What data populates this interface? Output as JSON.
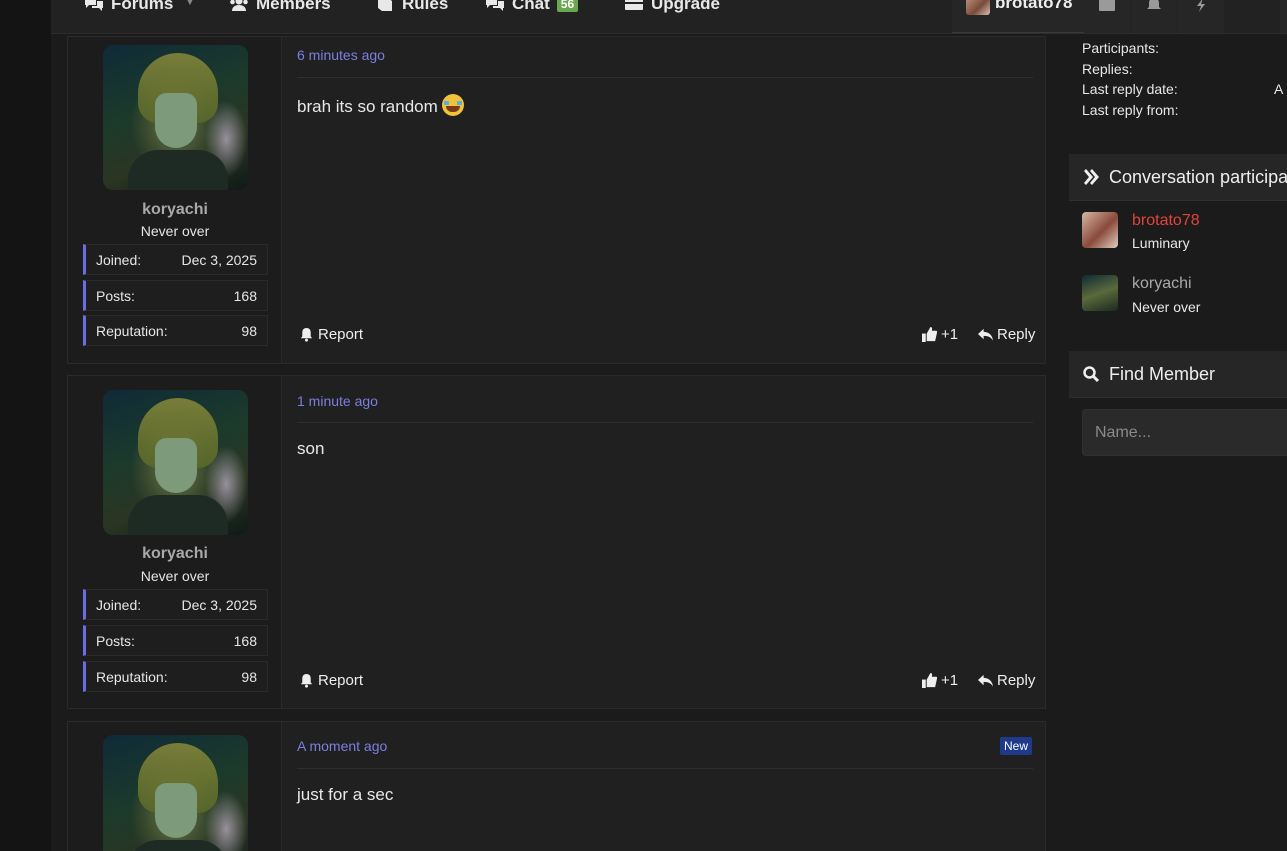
{
  "nav": {
    "items": [
      {
        "label": "Forums",
        "icon": "chat-bubbles-icon"
      },
      {
        "label": "Members",
        "icon": "users-icon"
      },
      {
        "label": "Rules",
        "icon": "book-icon"
      },
      {
        "label": "Chat",
        "icon": "chat-bubbles-icon",
        "badge": "56"
      },
      {
        "label": "Upgrade",
        "icon": "card-icon"
      }
    ],
    "user": "brotato78"
  },
  "posts": [
    {
      "author": "koryachi",
      "user_title": "Never over",
      "stats": [
        {
          "k": "Joined:",
          "v": "Dec 3, 2025"
        },
        {
          "k": "Posts:",
          "v": "168"
        },
        {
          "k": "Reputation:",
          "v": "98"
        }
      ],
      "time": "6 minutes ago",
      "text": "brah its so random",
      "emoji": "loudly-crying-face",
      "report": "Report",
      "like": "+1",
      "reply": "Reply"
    },
    {
      "author": "koryachi",
      "user_title": "Never over",
      "stats": [
        {
          "k": "Joined:",
          "v": "Dec 3, 2025"
        },
        {
          "k": "Posts:",
          "v": "168"
        },
        {
          "k": "Reputation:",
          "v": "98"
        }
      ],
      "time": "1 minute ago",
      "text": "son",
      "report": "Report",
      "like": "+1",
      "reply": "Reply"
    },
    {
      "time": "A moment ago",
      "text": "just for a sec",
      "badge": "New"
    }
  ],
  "sidebar": {
    "info": {
      "participants": "Participants:",
      "replies": "Replies:",
      "last_reply_date": "Last reply date:",
      "last_reply_date_value": "A",
      "last_reply_from": "Last reply from:"
    },
    "participants_title": "Conversation participa",
    "participants": [
      {
        "name": "brotato78",
        "title": "Luminary",
        "color": "#e0443a"
      },
      {
        "name": "koryachi",
        "title": "Never over",
        "color": "#a9a9a9"
      }
    ],
    "find_title": "Find Member",
    "find_placeholder": "Name..."
  },
  "colors": {
    "accent": "#6a6fe0",
    "link": "#7b7fe0",
    "chat_badge": "#6aa84f",
    "new_badge": "#1f3a8a"
  }
}
